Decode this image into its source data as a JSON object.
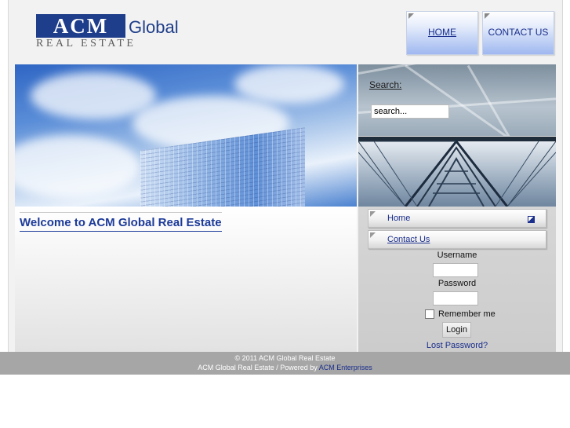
{
  "logo": {
    "acm": "ACM",
    "global": "Global",
    "real_estate": "REAL ESTATE"
  },
  "topnav": {
    "home": "HOME",
    "contact": "CONTACT US"
  },
  "search": {
    "label": "Search:",
    "value": "search..."
  },
  "main": {
    "welcome": "Welcome to ACM Global Real Estate"
  },
  "sidebar": {
    "menu": [
      {
        "label": "Home"
      },
      {
        "label": "Contact Us"
      }
    ],
    "login": {
      "username_label": "Username",
      "password_label": "Password",
      "remember_label": "Remember me",
      "login_button": "Login",
      "lost_password": "Lost Password?"
    }
  },
  "footer": {
    "copyright": "© 2011  ACM Global Real Estate",
    "powered_prefix": "ACM Global Real Estate / Powered by ",
    "powered_link": "ACM Enterprises"
  },
  "colors": {
    "brand_blue": "#1e3d8a",
    "link_blue": "#1b2f8c",
    "footer_bg": "#a6a6a6"
  }
}
